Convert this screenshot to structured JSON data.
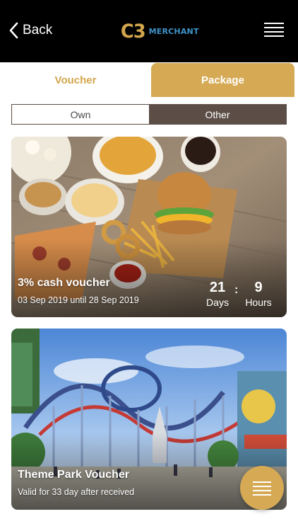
{
  "header": {
    "back_label": "Back",
    "logo_main": "C3",
    "logo_sub": "MERCHANT"
  },
  "tabs": [
    {
      "label": "Voucher",
      "active": true
    },
    {
      "label": "Package",
      "active": false
    }
  ],
  "segment": [
    {
      "label": "Own",
      "active": false
    },
    {
      "label": "Other",
      "active": true
    }
  ],
  "cards": [
    {
      "title": "3% cash voucher",
      "subtitle": "03 Sep 2019 until 28 Sep 2019",
      "countdown": {
        "days_value": "21",
        "days_label": "Days",
        "separator": ":",
        "hours_value": "9",
        "hours_label": "Hours"
      }
    },
    {
      "title": "Theme Park Voucher",
      "subtitle": "Valid for 33 day after received"
    }
  ],
  "colors": {
    "gold": "#d6aa55",
    "header_bg": "#000000",
    "segment_dark": "#5c4e46",
    "logo_blue": "#3f93c9"
  },
  "icons": [
    "chevron-left-icon",
    "hamburger-menu-icon",
    "fab-menu-icon"
  ]
}
